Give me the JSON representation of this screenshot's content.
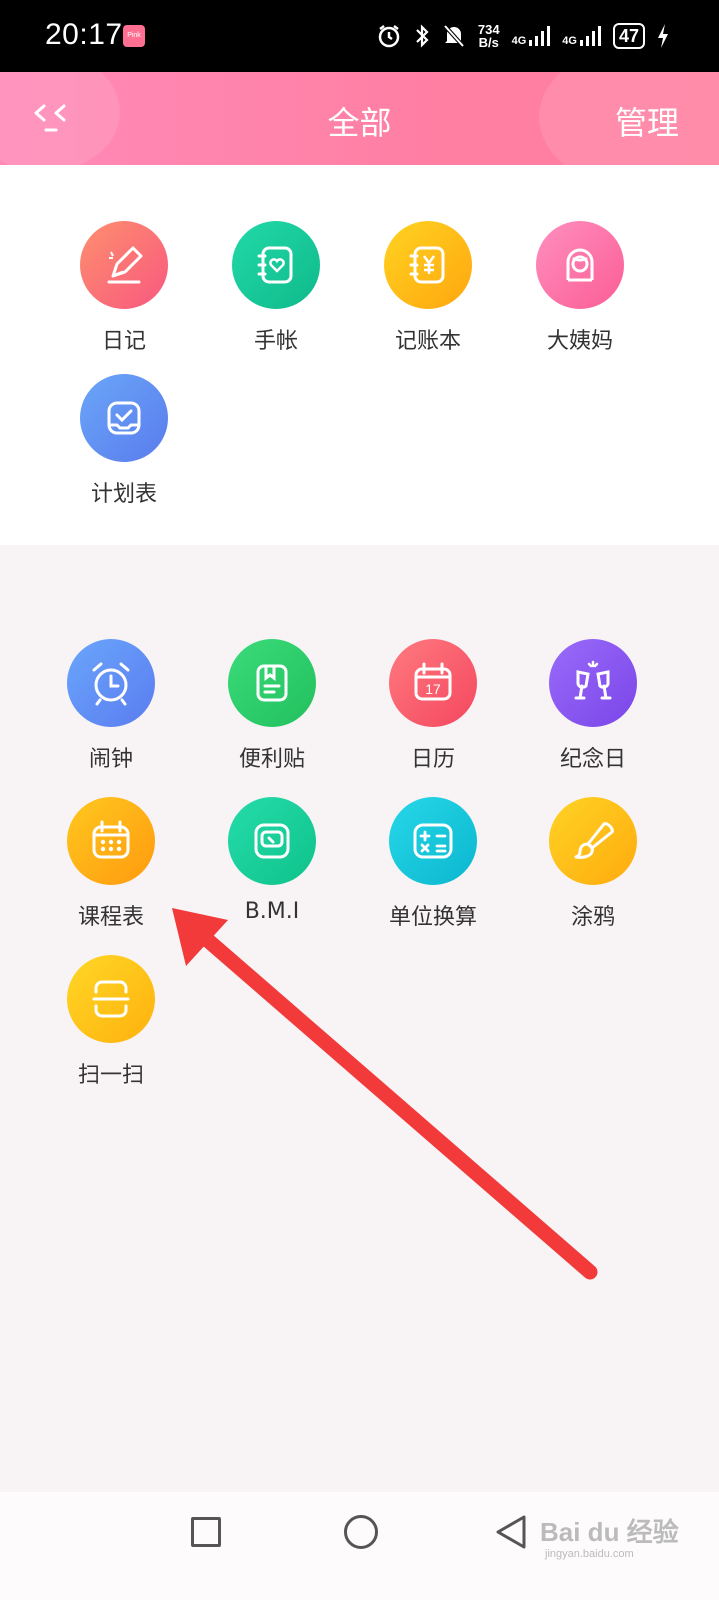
{
  "status_bar": {
    "time": "20:17",
    "app_badge": "Pink",
    "speed_top": "734",
    "speed_bottom": "B/s",
    "net1": "4G",
    "net2": "4G",
    "battery": "47"
  },
  "header": {
    "title": "全部",
    "manage": "管理",
    "background": "#ff7fa3"
  },
  "top_section": {
    "items": [
      {
        "label": "日记",
        "icon": "pencil-icon",
        "color": "#fb6f7f"
      },
      {
        "label": "手帐",
        "icon": "heart-notebook-icon",
        "color": "#16c79a"
      },
      {
        "label": "记账本",
        "icon": "yen-book-icon",
        "color": "#ffbd18"
      },
      {
        "label": "大姨妈",
        "icon": "girl-icon",
        "color": "#ff72a6"
      },
      {
        "label": "计划表",
        "icon": "check-tray-icon",
        "color": "#5f8ff2"
      }
    ]
  },
  "bottom_section": {
    "items": [
      {
        "label": "闹钟",
        "icon": "alarm-clock-icon",
        "color": "#5b8df6"
      },
      {
        "label": "便利贴",
        "icon": "sticky-note-icon",
        "color": "#2fcf6c"
      },
      {
        "label": "日历",
        "icon": "calendar-icon",
        "color": "#fc5f6f",
        "badge": "17"
      },
      {
        "label": "纪念日",
        "icon": "champagne-icon",
        "color": "#8c5cf3"
      },
      {
        "label": "课程表",
        "icon": "schedule-icon",
        "color": "#ffb213"
      },
      {
        "label": "B.M.I",
        "icon": "scale-icon",
        "color": "#19cf9f"
      },
      {
        "label": "单位换算",
        "icon": "calculator-icon",
        "color": "#17c6dc"
      },
      {
        "label": "涂鸦",
        "icon": "brush-icon",
        "color": "#ffbe16"
      },
      {
        "label": "扫一扫",
        "icon": "scan-icon",
        "color": "#ffc414"
      }
    ]
  },
  "watermark": {
    "text": "Bai du 经验",
    "sub": "jingyan.baidu.com"
  },
  "annotation_color": "#f23a3a"
}
